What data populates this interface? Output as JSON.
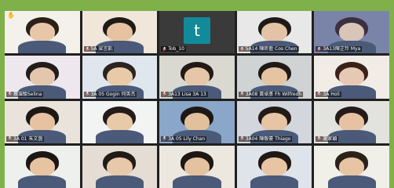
{
  "participants": [
    {
      "label": "",
      "initial": "",
      "hand": true,
      "bg": "#f4f1ea",
      "skin": "#e8c7a8",
      "hair": "#2b2018"
    },
    {
      "label": "5A 梁言凱",
      "initial": "",
      "hand": false,
      "bg": "#f0e6d9",
      "skin": "#e6c2a0",
      "hair": "#1f1a16"
    },
    {
      "label": "Tob_10",
      "initial": "t",
      "hand": false,
      "bg": "#3a3a3a",
      "skin": "",
      "hair": ""
    },
    {
      "label": "5A14 陳昕盈 Cos Chen",
      "initial": "",
      "hand": false,
      "bg": "#e8e8e8",
      "skin": "#e4c2a6",
      "hair": "#1e1a18"
    },
    {
      "label": "3A13陳芷玲 Mya",
      "initial": "",
      "hand": false,
      "bg": "#7a84a8",
      "skin": "#d9c4b8",
      "hair": "#3a3040"
    },
    {
      "label": "蔡靄駿Selina",
      "initial": "",
      "hand": false,
      "bg": "#eee8ee",
      "skin": "#e4c6ae",
      "hair": "#221c1a"
    },
    {
      "label": "3A 05 Gogin 何英杰",
      "initial": "",
      "hand": false,
      "bg": "#dfe6ee",
      "skin": "#e8caa8",
      "hair": "#2c2420"
    },
    {
      "label": "3A13 Lisa 3A 13",
      "initial": "",
      "hand": false,
      "bg": "#d9d9d2",
      "skin": "#e6c6a8",
      "hair": "#221a16"
    },
    {
      "label": "3A08 黃卓彥 Fh Wilfredh",
      "initial": "",
      "hand": false,
      "bg": "#cfd3d3",
      "skin": "#e4c4a2",
      "hair": "#201a16"
    },
    {
      "label": "3A Holi",
      "initial": "",
      "hand": false,
      "bg": "#f1ece6",
      "skin": "#e6c9b2",
      "hair": "#3a2218"
    },
    {
      "label": "3A 01 朱文茵",
      "initial": "",
      "hand": false,
      "bg": "#e9e3dc",
      "skin": "#e6c2a0",
      "hair": "#1c1814"
    },
    {
      "label": "",
      "initial": "",
      "hand": false,
      "bg": "#f2f4f4",
      "skin": "#e8caa8",
      "hair": "#241c18"
    },
    {
      "label": "3A 05 Lily Chan",
      "initial": "",
      "hand": false,
      "bg": "#8aa6c8",
      "skin": "#e2c09c",
      "hair": "#1e1816"
    },
    {
      "label": "3A04 陳敬豪 Thiago",
      "initial": "",
      "hand": false,
      "bg": "#d3d6dc",
      "skin": "#e6c4a4",
      "hair": "#211a16"
    },
    {
      "label": "謝家穎",
      "initial": "",
      "hand": false,
      "bg": "#e2e2de",
      "skin": "#e6c2a2",
      "hair": "#231b17"
    },
    {
      "label": "",
      "initial": "",
      "hand": false,
      "bg": "#eef0ee",
      "skin": "#e6c4a2",
      "hair": "#1c1714"
    },
    {
      "label": "",
      "initial": "",
      "hand": false,
      "bg": "#e5ddd4",
      "skin": "#e8c8aa",
      "hair": "#211b17"
    },
    {
      "label": "",
      "initial": "",
      "hand": false,
      "bg": "#ece8e0",
      "skin": "#e4c2a0",
      "hair": "#1e1815"
    },
    {
      "label": "",
      "initial": "",
      "hand": false,
      "bg": "#dfe4ea",
      "skin": "#e6c4a4",
      "hair": "#1f1915"
    },
    {
      "label": "",
      "initial": "",
      "hand": false,
      "bg": "#f0efe8",
      "skin": "#e6c4a4",
      "hair": "#2a211b"
    }
  ],
  "active_index": 7,
  "colors": {
    "frame": "#7fb04a",
    "active_border": "#c6e06a",
    "avatar": "#138a9a"
  }
}
